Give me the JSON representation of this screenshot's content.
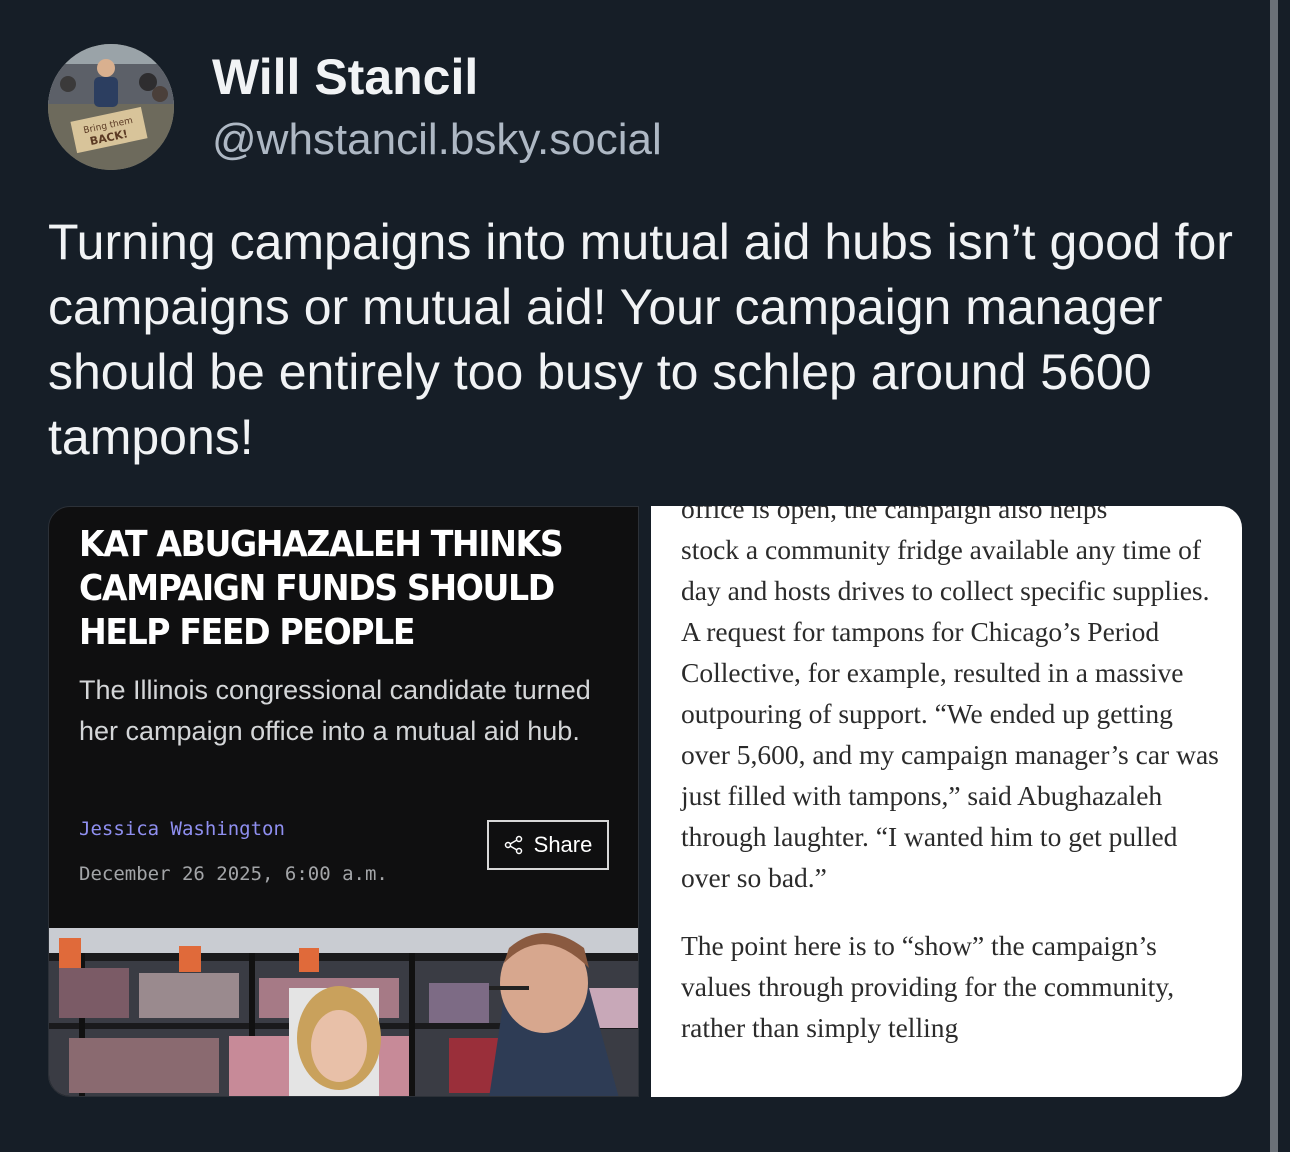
{
  "post": {
    "display_name": "Will Stancil",
    "handle": "@whstancil.bsky.social",
    "avatar_sign": [
      "Bring them",
      "BACK!"
    ],
    "text": "Turning campaigns into mutual aid hubs isn’t good for campaigns or mutual aid! Your campaign manager should be entirely too busy to schlep around 5600 tampons!"
  },
  "embed_left": {
    "headline_lines": [
      "KAT ABUGHAZALEH THINKS",
      "CAMPAIGN FUNDS SHOULD",
      "HELP FEED PEOPLE"
    ],
    "dek": "The Illinois congressional candidate turned her campaign office into a mutual aid hub.",
    "author": "Jessica Washington",
    "date": "December 26 2025, 6:00 a.m.",
    "share_label": "Share",
    "share_icon": "share-icon"
  },
  "embed_right": {
    "cut_top_line": "office is open, the campaign also helps",
    "paragraph1": "stock a community fridge available any time of day and hosts drives to collect specific supplies. A request for tampons for Chicago’s Period Collective, for example, resulted in a massive outpouring of support. “We ended up getting over 5,600, and my campaign manager’s car was just filled with tampons,” said Abughazaleh through laughter. “I wanted him to get pulled over so bad.”",
    "paragraph2": "The point here is to “show” the campaign’s values through providing for the community, rather than simply telling"
  },
  "colors": {
    "background": "#161e27",
    "author_link": "#8f8ff0",
    "handle": "#aeb8c4"
  }
}
